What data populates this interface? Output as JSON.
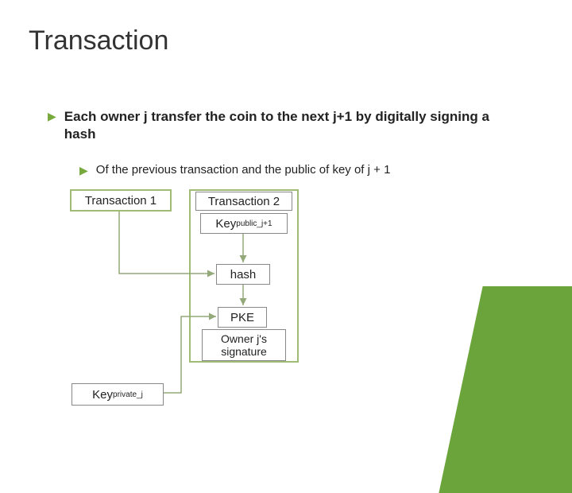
{
  "title": "Transaction",
  "bullets": {
    "main": "Each owner j transfer the coin to the next j+1 by digitally signing a hash",
    "sub": "Of the previous transaction and the public of key of j + 1"
  },
  "boxes": {
    "tx1": "Transaction 1",
    "tx2": "Transaction 2",
    "key_public_prefix": "Key",
    "key_public_sub": "public_j+1",
    "hash": "hash",
    "pke": "PKE",
    "signature": "Owner j's signature",
    "key_private_prefix": "Key",
    "key_private_sub": "private_j"
  },
  "colors": {
    "accent": "#6BA43A",
    "box_border": "#9FBB74",
    "arrow": "#94A97A"
  }
}
